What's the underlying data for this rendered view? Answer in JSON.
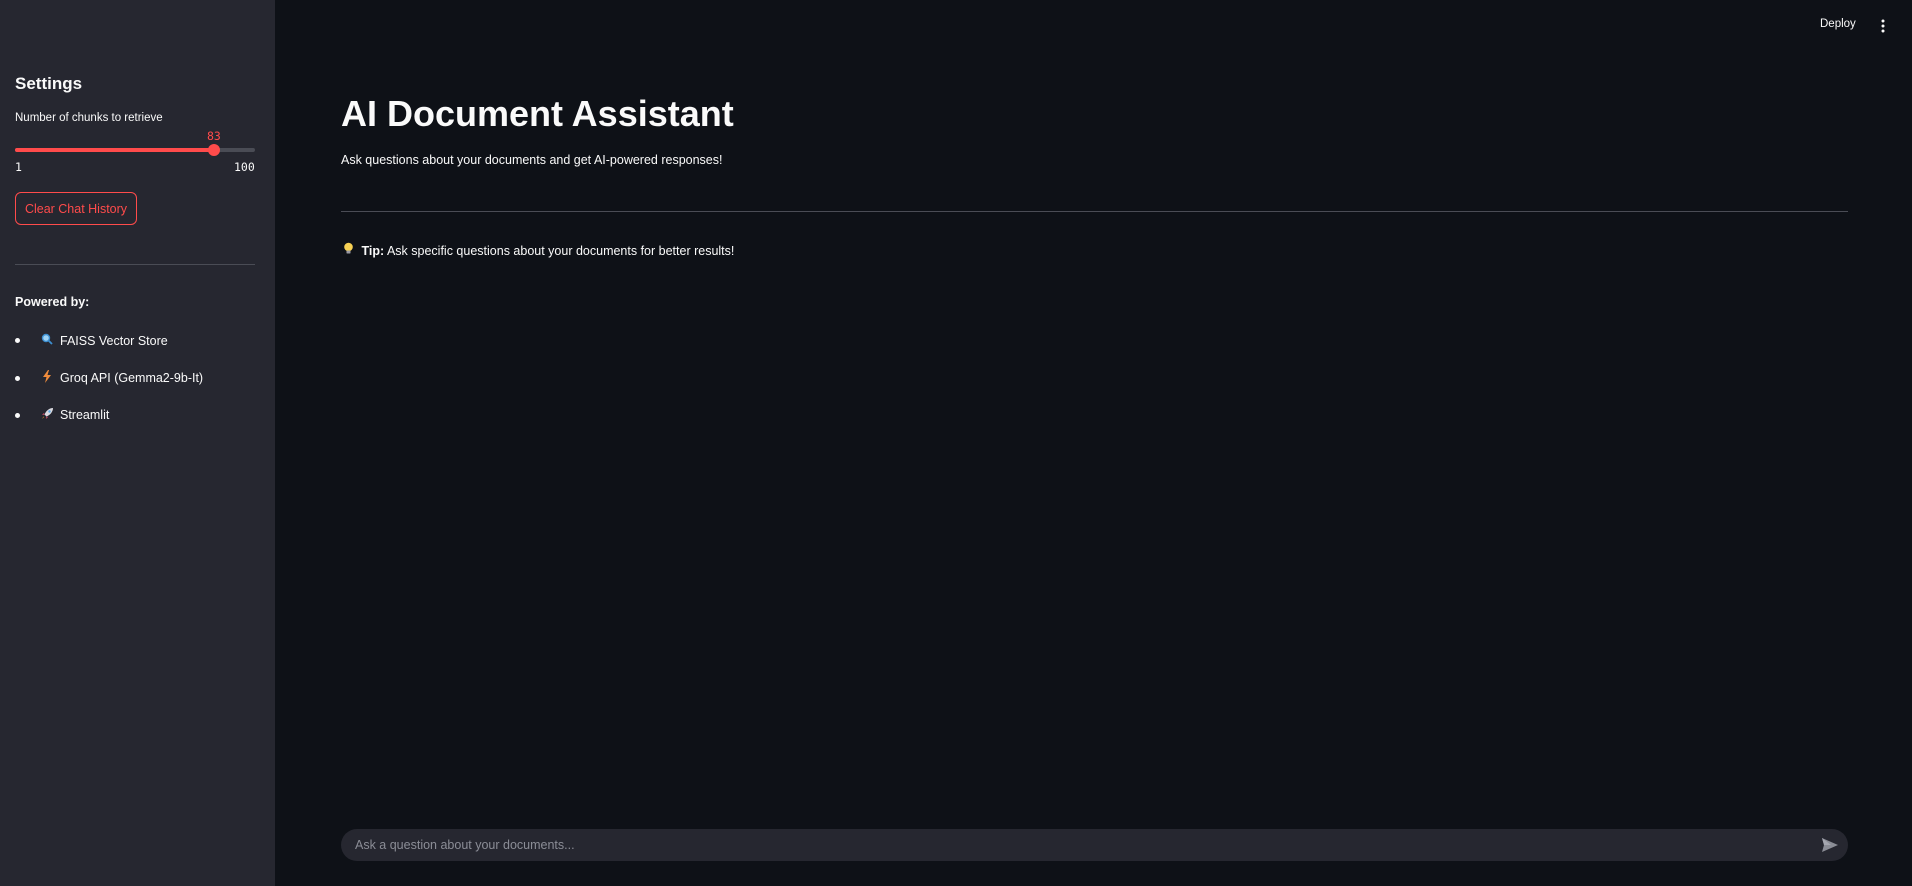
{
  "sidebar": {
    "title": "Settings",
    "slider": {
      "label": "Number of chunks to retrieve",
      "value": "83",
      "min": "1",
      "max": "100"
    },
    "clear_button": "Clear Chat History",
    "powered_by": "Powered by:",
    "items": [
      {
        "icon": "search-icon",
        "label": "FAISS Vector Store"
      },
      {
        "icon": "lightning-icon",
        "label": "Groq API (Gemma2-9b-It)"
      },
      {
        "icon": "rocket-icon",
        "label": "Streamlit"
      }
    ]
  },
  "header": {
    "deploy_label": "Deploy",
    "menu_icon": "more-vertical-icon"
  },
  "main": {
    "title": "AI Document Assistant",
    "subtitle": "Ask questions about your documents and get AI-powered responses!",
    "tip": {
      "icon": "lightbulb-icon",
      "label": "Tip:",
      "text": "Ask specific questions about your documents for better results!"
    },
    "chat": {
      "placeholder": "Ask a question about your documents...",
      "send_icon": "send-icon"
    }
  },
  "colors": {
    "background": "#0e1117",
    "sidebar": "#262730",
    "accent": "#ff4b4b",
    "text": "#fafafa"
  }
}
